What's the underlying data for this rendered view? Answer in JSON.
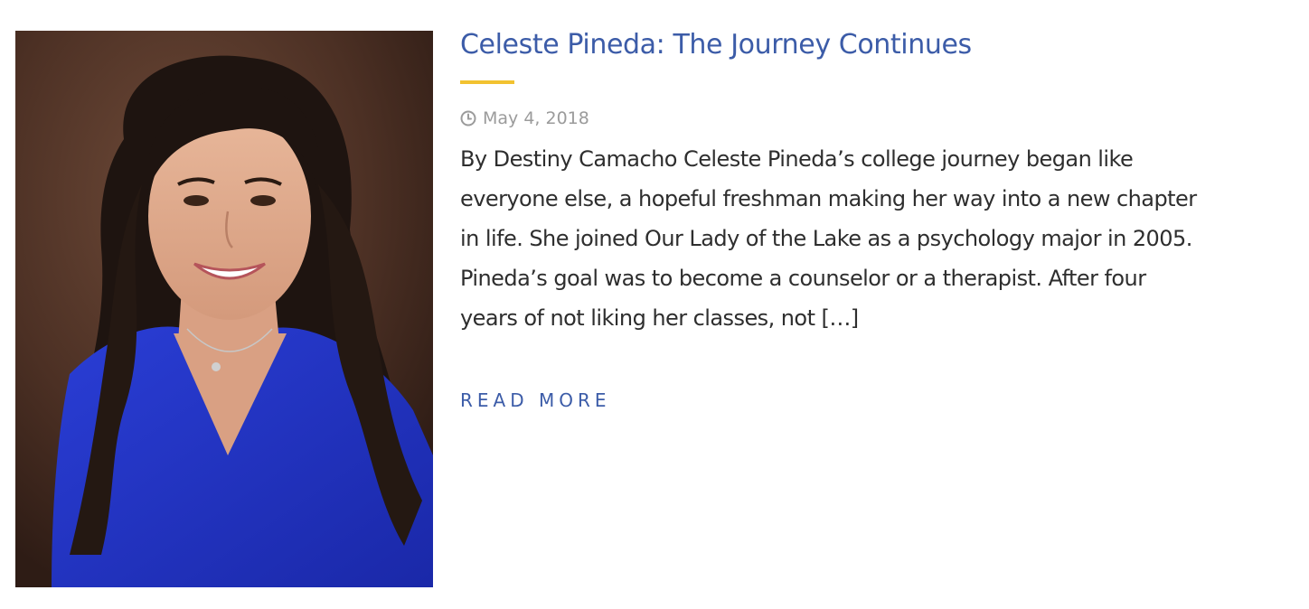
{
  "post": {
    "image_alt": "Celeste Pineda portrait",
    "title": "Celeste Pineda: The Journey Continues",
    "date": "May 4, 2018",
    "date_icon": "clock-icon",
    "excerpt_lines": [
      "By Destiny Camacho Celeste Pineda’s college journey began like",
      "everyone else, a hopeful freshman making her way into a new chapter",
      "in life. She joined Our Lady of the Lake as a psychology major in 2005.",
      "Pineda’s goal was to become a counselor or a therapist. After four",
      "years of not liking her classes, not […]"
    ],
    "read_more_label": "READ MORE"
  },
  "colors": {
    "title": "#3c5ca8",
    "accent_rule": "#f2c230",
    "meta": "#9b9b9b",
    "body_text": "#2e2e2e",
    "link": "#3c5ca8"
  }
}
